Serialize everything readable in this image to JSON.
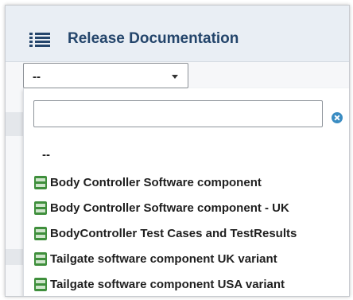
{
  "header": {
    "title": "Release Documentation"
  },
  "select": {
    "value": "--"
  },
  "dropdown": {
    "search_value": "",
    "options": [
      {
        "label": "--",
        "icon": ""
      },
      {
        "label": "Body Controller Software component",
        "icon": "database-icon"
      },
      {
        "label": "Body Controller Software component - UK",
        "icon": "database-icon"
      },
      {
        "label": "BodyController Test Cases and TestResults",
        "icon": "database-icon"
      },
      {
        "label": "Tailgate software component UK variant",
        "icon": "database-icon"
      },
      {
        "label": "Tailgate software component USA variant",
        "icon": "database-icon"
      }
    ]
  },
  "colors": {
    "title": "#24456b",
    "icon_green": "#3f8f3c",
    "clear_blue": "#3a8cc2"
  }
}
